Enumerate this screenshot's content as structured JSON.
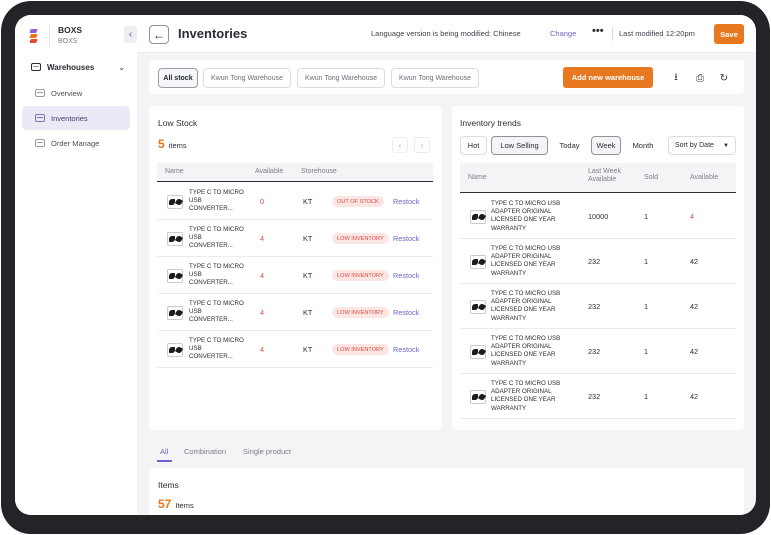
{
  "sidebar": {
    "brand_name": "BOXS",
    "brand_sub": "BOXS",
    "collapse_icon": "chevron-left-icon",
    "group_label": "Warehouses",
    "items": [
      {
        "label": "Overview",
        "icon": "warehouse-icon"
      },
      {
        "label": "Inventories",
        "icon": "inventory-icon",
        "active": true
      },
      {
        "label": "Order Manage",
        "icon": "order-icon"
      }
    ]
  },
  "header": {
    "title": "Inventories",
    "lang_message": "Language version is being modified: Chinese",
    "lang_change": "Change",
    "more": "•••",
    "last_modified": "Last modified 12:20pm",
    "save_label": "Save"
  },
  "toolbar": {
    "tabs": [
      "All stock",
      "Kwun Tong Warehouse",
      "Kwun Tong Warehouse",
      "Kwun Tong Warehouse"
    ],
    "add_label": "Add new warehouse",
    "icons": [
      "download-icon",
      "print-icon",
      "refresh-icon"
    ]
  },
  "low_stock": {
    "title": "Low Stock",
    "count": "5",
    "count_label": "items",
    "columns": [
      "Name",
      "Available",
      "Storehouse"
    ],
    "rows": [
      {
        "name": [
          "TYPE C TO MICRO",
          "USB",
          "CONVERTER..."
        ],
        "available": "0",
        "storehouse": "KT",
        "status": "OUT OF STOCK",
        "action": "Restock"
      },
      {
        "name": [
          "TYPE C TO MICRO",
          "USB",
          "CONVERTER..."
        ],
        "available": "4",
        "storehouse": "KT",
        "status": "LOW INVENTORY",
        "action": "Restock"
      },
      {
        "name": [
          "TYPE C TO MICRO",
          "USB",
          "CONVERTER..."
        ],
        "available": "4",
        "storehouse": "KT",
        "status": "LOW INVENTORY",
        "action": "Restock"
      },
      {
        "name": [
          "TYPE C TO MICRO",
          "USB",
          "CONVERTER..."
        ],
        "available": "4",
        "storehouse": "KT",
        "status": "LOW INVENTORY",
        "action": "Restock"
      },
      {
        "name": [
          "TYPE C TO MICRO",
          "USB",
          "CONVERTER..."
        ],
        "available": "4",
        "storehouse": "KT",
        "status": "LOW INVENTORY",
        "action": "Restock"
      }
    ]
  },
  "trends": {
    "title": "Inventory trends",
    "filters": [
      "Hot",
      "Low Selling",
      "Today",
      "Week",
      "Month"
    ],
    "sort_label": "Sort by Date",
    "columns": [
      "Name",
      "Last Week",
      "Available",
      "Sold",
      "Available"
    ],
    "rows": [
      {
        "name": [
          "TYPE C TO MICRO USB",
          "ADAPTER ORIGINAL",
          "LICENSED ONE YEAR",
          "WARRANTY"
        ],
        "last_week": "10000",
        "sold": "1",
        "available": "4"
      },
      {
        "name": [
          "TYPE C TO MICRO USB",
          "ADAPTER ORIGINAL",
          "LICENSED ONE YEAR",
          "WARRANTY"
        ],
        "last_week": "232",
        "sold": "1",
        "available": "42"
      },
      {
        "name": [
          "TYPE C TO MICRO USB",
          "ADAPTER ORIGINAL",
          "LICENSED ONE YEAR",
          "WARRANTY"
        ],
        "last_week": "232",
        "sold": "1",
        "available": "42"
      },
      {
        "name": [
          "TYPE C TO MICRO USB",
          "ADAPTER ORIGINAL",
          "LICENSED ONE YEAR",
          "WARRANTY"
        ],
        "last_week": "232",
        "sold": "1",
        "available": "42"
      },
      {
        "name": [
          "TYPE C TO MICRO USB",
          "ADAPTER ORIGINAL",
          "LICENSED ONE YEAR",
          "WARRANTY"
        ],
        "last_week": "232",
        "sold": "1",
        "available": "42"
      }
    ]
  },
  "bottom_tabs": [
    "All",
    "Combination",
    "Single product"
  ],
  "items_panel": {
    "title": "Items",
    "count": "57",
    "count_label": "Items"
  },
  "colors": {
    "accent": "#e8781f",
    "link": "#6d64c8",
    "danger": "#e0483e"
  }
}
